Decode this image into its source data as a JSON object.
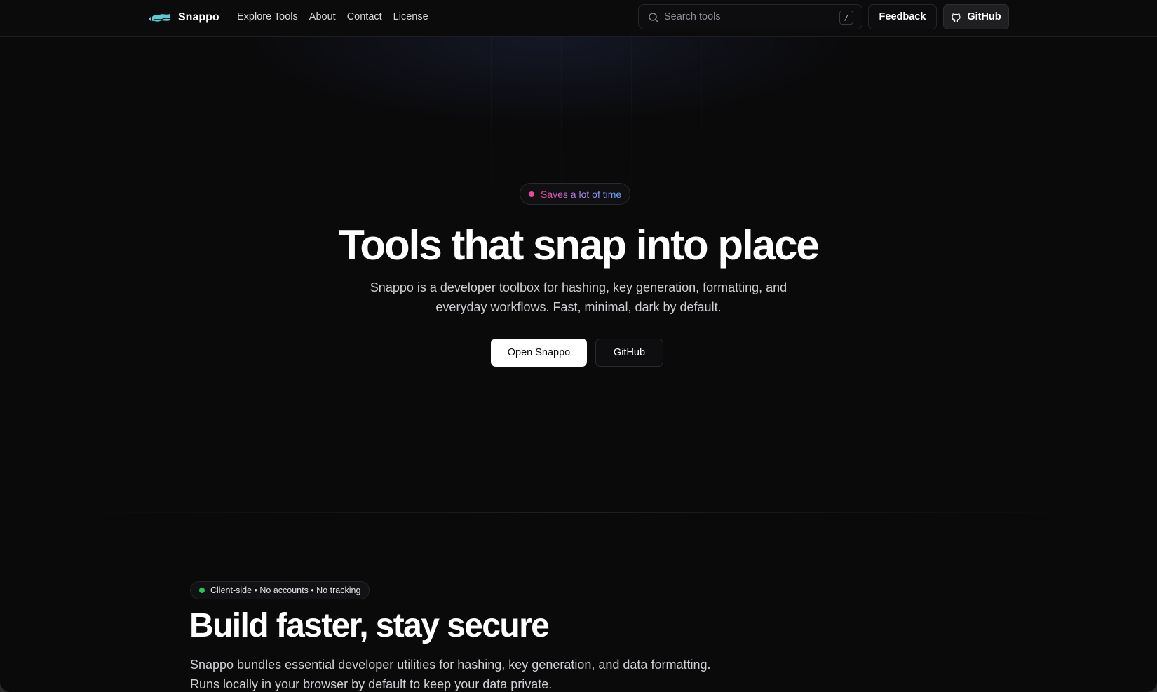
{
  "nav": {
    "brand": "Snappo",
    "logo_icon": "snappo-logo-icon",
    "links": [
      "Explore Tools",
      "About",
      "Contact",
      "License"
    ],
    "search": {
      "placeholder": "Search tools",
      "shortcut": "/"
    },
    "feedback_label": "Feedback",
    "github_label": "GitHub"
  },
  "hero": {
    "badge": "Saves a lot of time",
    "title": "Tools that snap into place",
    "subtitle": "Snappo is a developer toolbox for hashing, key generation, formatting, and everyday workflows. Fast, minimal, dark by default.",
    "primary_cta": "Open Snappo",
    "secondary_cta": "GitHub"
  },
  "features": {
    "badge": "Client-side • No accounts • No tracking",
    "title": "Build faster, stay secure",
    "subtitle": "Snappo bundles essential developer utilities for hashing, key generation, and data formatting. Runs locally in your browser by default to keep your data private."
  },
  "colors": {
    "background": "#0a0a0b",
    "badge_dot_pink": "#ec4899",
    "badge_dot_green": "#22c55e",
    "logo_teal": "#5fc9d6"
  }
}
